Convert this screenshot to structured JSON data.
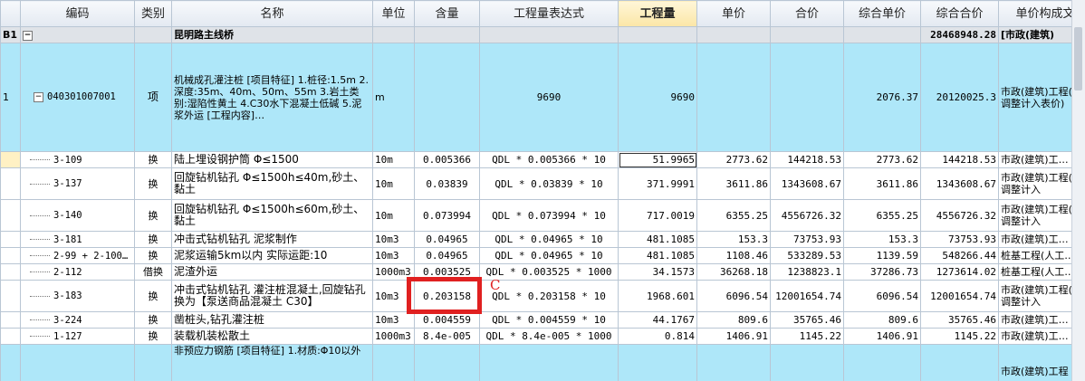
{
  "columns": [
    "",
    "编码",
    "类别",
    "名称",
    "单位",
    "含量",
    "工程量表达式",
    "工程量",
    "单价",
    "合价",
    "综合单价",
    "综合合价",
    "单价构成文件"
  ],
  "section": {
    "index": "B1",
    "toggle": "−",
    "name": "昆明路主线桥",
    "total": "28468948.28",
    "unit_file": "[市政(建筑)"
  },
  "item1": {
    "index": "1",
    "toggle": "−",
    "code": "040301007001",
    "category": "项",
    "name": "机械成孔灌注桩\n[项目特征]\n1.桩径:1.5m\n2.深度:35m、40m、50m、55m\n3.岩土类别:湿陷性黄土\n4.C30水下混凝土低碱\n5.泥浆外运\n[工程内容]…",
    "unit": "m",
    "expression": "9690",
    "quantity": "9690",
    "comp_unit_price": "2076.37",
    "comp_total": "20120025.3",
    "unit_file": "市政(建筑)工程(人工调整计入表价)"
  },
  "subrows": [
    {
      "code": "3-109",
      "category": "换",
      "name": "陆上埋设钢护筒 Φ≤1500",
      "unit": "10m",
      "content": "0.005366",
      "expression": "QDL * 0.005366 * 10",
      "quantity": "51.9965",
      "unit_price": "2773.62",
      "total": "144218.53",
      "comp_unit_price": "2773.62",
      "comp_total": "144218.53",
      "unit_file": "市政(建筑)工…"
    },
    {
      "code": "3-137",
      "category": "换",
      "name": "回旋钻机钻孔 Φ≤1500h≤40m,砂土、黏土",
      "unit": "10m",
      "content": "0.03839",
      "expression": "QDL * 0.03839 * 10",
      "quantity": "371.9991",
      "unit_price": "3611.86",
      "total": "1343608.67",
      "comp_unit_price": "3611.86",
      "comp_total": "1343608.67",
      "unit_file": "市政(建筑)工程(人工调整计入"
    },
    {
      "code": "3-140",
      "category": "换",
      "name": "回旋钻机钻孔 Φ≤1500h≤60m,砂土、黏土",
      "unit": "10m",
      "content": "0.073994",
      "expression": "QDL * 0.073994 * 10",
      "quantity": "717.0019",
      "unit_price": "6355.25",
      "total": "4556726.32",
      "comp_unit_price": "6355.25",
      "comp_total": "4556726.32",
      "unit_file": "市政(建筑)工程(人工调整计入"
    },
    {
      "code": "3-181",
      "category": "换",
      "name": "冲击式钻机钻孔 泥浆制作",
      "unit": "10m3",
      "content": "0.04965",
      "expression": "QDL * 0.04965 * 10",
      "quantity": "481.1085",
      "unit_price": "153.3",
      "total": "73753.93",
      "comp_unit_price": "153.3",
      "comp_total": "73753.93",
      "unit_file": "市政(建筑)工…"
    },
    {
      "code": "2-99 + 2-100…",
      "category": "换",
      "name": "泥浆运输5km以内 实际运距:10",
      "unit": "10m3",
      "content": "0.04965",
      "expression": "QDL * 0.04965 * 10",
      "quantity": "481.1085",
      "unit_price": "1108.46",
      "total": "533289.53",
      "comp_unit_price": "1139.59",
      "comp_total": "548266.44",
      "unit_file": "桩基工程(人工…"
    },
    {
      "code": "2-112",
      "category": "借换",
      "name": "泥渣外运",
      "unit": "1000m3",
      "content": "0.003525",
      "expression": "QDL * 0.003525 * 1000",
      "quantity": "34.1573",
      "unit_price": "36268.18",
      "total": "1238823.1",
      "comp_unit_price": "37286.73",
      "comp_total": "1273614.02",
      "unit_file": "桩基工程(人工…"
    },
    {
      "code": "3-183",
      "category": "换",
      "name": "冲击式钻机钻孔 灌注桩混凝土,回旋钻孔 换为【泵送商品混凝土 C30】",
      "unit": "10m3",
      "content": "0.203158",
      "expression": "QDL * 0.203158 * 10",
      "quantity": "1968.601",
      "unit_price": "6096.54",
      "total": "12001654.74",
      "comp_unit_price": "6096.54",
      "comp_total": "12001654.74",
      "unit_file": "市政(建筑)工程(人工调整计入"
    },
    {
      "code": "3-224",
      "category": "换",
      "name": "凿桩头,钻孔灌注桩",
      "unit": "10m3",
      "content": "0.004559",
      "expression": "QDL * 0.004559 * 10",
      "quantity": "44.1767",
      "unit_price": "809.6",
      "total": "35765.46",
      "comp_unit_price": "809.6",
      "comp_total": "35765.46",
      "unit_file": "市政(建筑)工…"
    },
    {
      "code": "1-127",
      "category": "换",
      "name": "装载机装松散土",
      "unit": "1000m3",
      "content": "8.4e-005",
      "expression": "QDL * 8.4e-005 * 1000",
      "quantity": "0.814",
      "unit_price": "1406.91",
      "total": "1145.22",
      "comp_unit_price": "1406.91",
      "comp_total": "1145.22",
      "unit_file": "市政(建筑)工…"
    }
  ],
  "item2": {
    "name": "非预应力钢筋\n[项目特征]\n1.材质:Φ10以外",
    "unit_file": "市政(建筑)工程"
  },
  "annotation": {
    "label": "C",
    "color": "#e02020"
  },
  "colors": {
    "item_row": "#aee7f9",
    "section_row": "#dfe3e8",
    "active_header": "#fbe6a6"
  }
}
